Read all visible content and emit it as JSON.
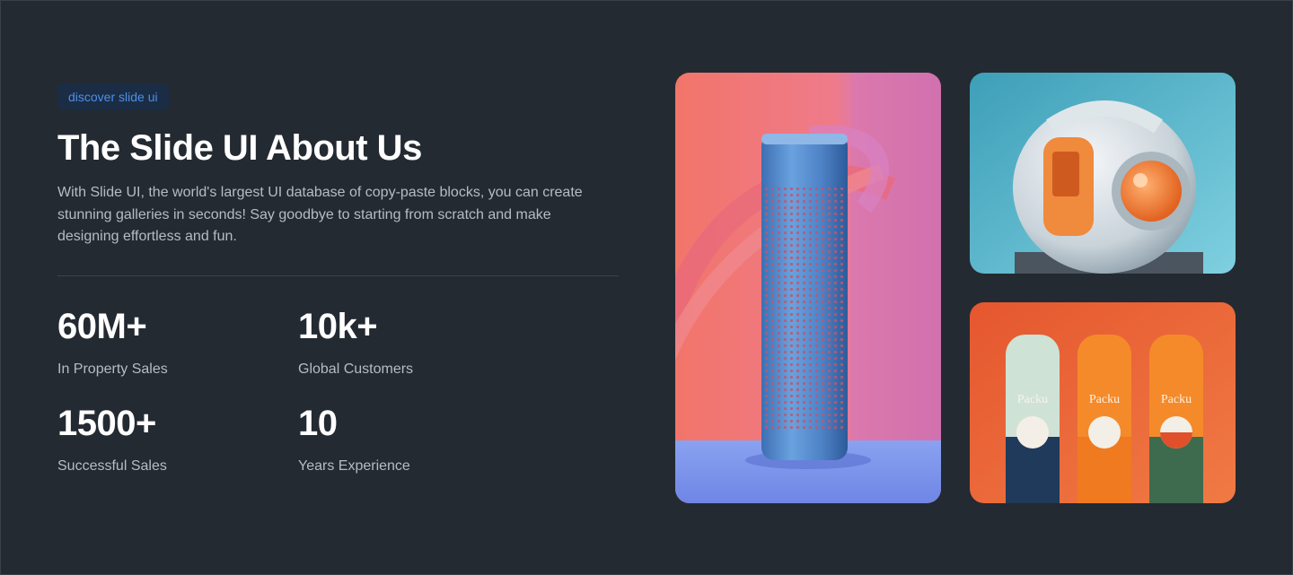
{
  "hero": {
    "badge": "discover slide ui",
    "title": "The Slide UI About Us",
    "description": "With Slide UI, the world's largest UI database of copy-paste blocks, you can create stunning galleries in seconds! Say goodbye to starting from scratch and make designing effortless and fun."
  },
  "stats": [
    {
      "value": "60M+",
      "label": "In Property Sales"
    },
    {
      "value": "10k+",
      "label": "Global Customers"
    },
    {
      "value": "1500+",
      "label": "Successful Sales"
    },
    {
      "value": "10",
      "label": "Years Experience"
    }
  ],
  "gallery": {
    "bottle_brand": "Packu"
  },
  "colors": {
    "background": "#242a31",
    "badge_bg": "#1b2c45",
    "badge_text": "#4f8fe6",
    "muted_text": "#b6bcc4"
  }
}
